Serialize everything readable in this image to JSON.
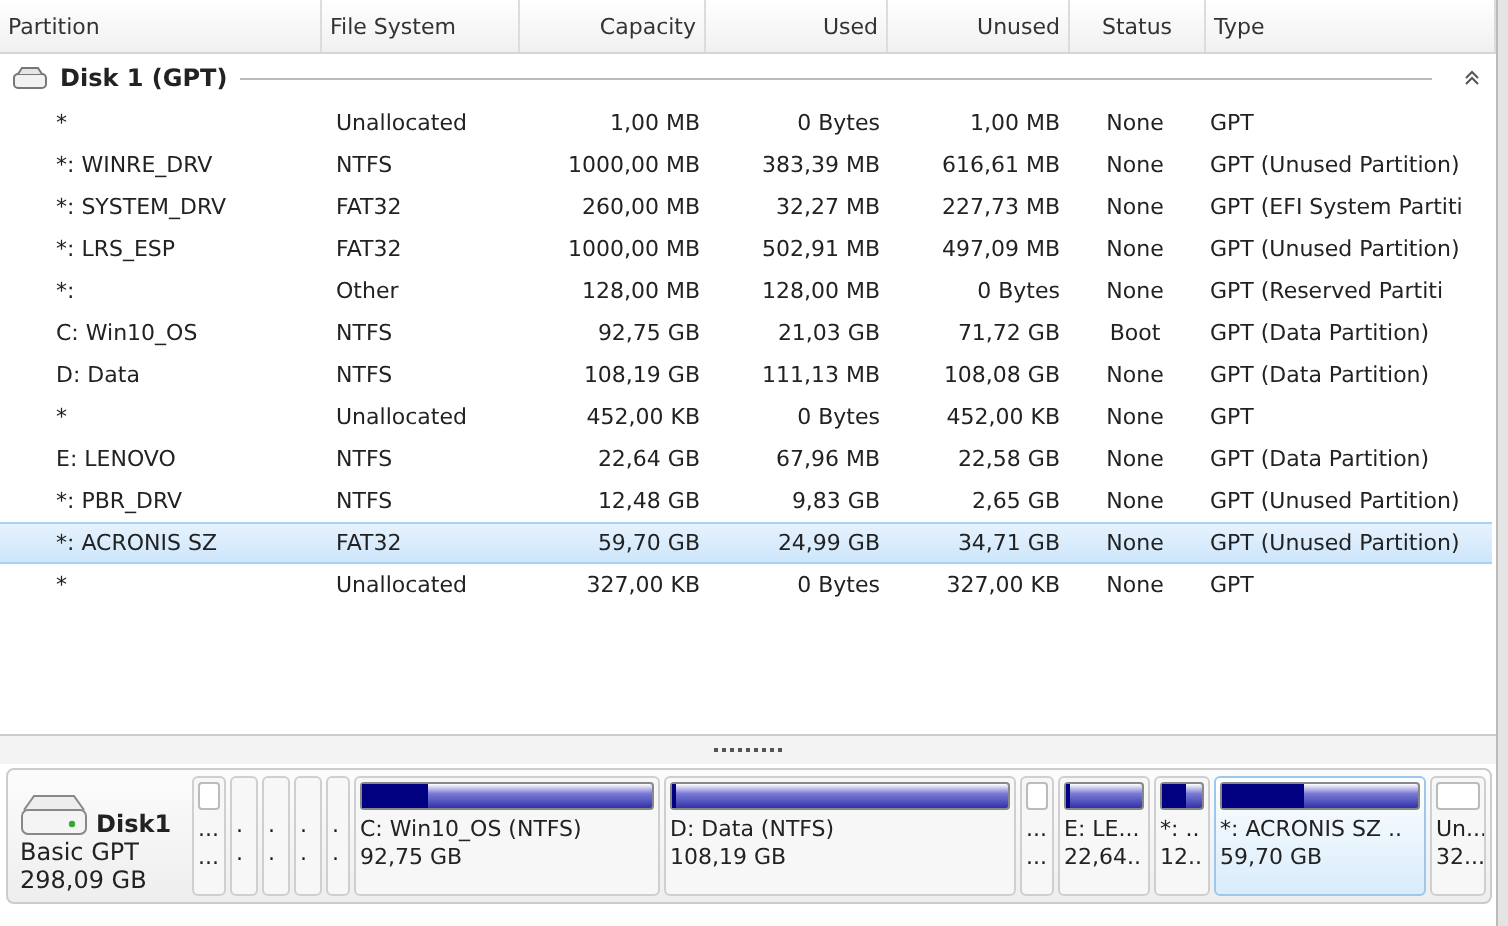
{
  "columns": [
    "Partition",
    "File System",
    "Capacity",
    "Used",
    "Unused",
    "Status",
    "Type"
  ],
  "disk_group": {
    "title": "Disk 1 (GPT)",
    "expanded": true
  },
  "rows": [
    {
      "cells": [
        "*",
        "Unallocated",
        "1,00 MB",
        "0 Bytes",
        "1,00 MB",
        "None",
        "GPT"
      ],
      "selected": false
    },
    {
      "cells": [
        "*: WINRE_DRV",
        "NTFS",
        "1000,00 MB",
        "383,39 MB",
        "616,61 MB",
        "None",
        "GPT (Unused Partition)"
      ],
      "selected": false
    },
    {
      "cells": [
        "*: SYSTEM_DRV",
        "FAT32",
        "260,00 MB",
        "32,27 MB",
        "227,73 MB",
        "None",
        "GPT (EFI System Partiti"
      ],
      "selected": false
    },
    {
      "cells": [
        "*: LRS_ESP",
        "FAT32",
        "1000,00 MB",
        "502,91 MB",
        "497,09 MB",
        "None",
        "GPT (Unused Partition)"
      ],
      "selected": false
    },
    {
      "cells": [
        "*:",
        "Other",
        "128,00 MB",
        "128,00 MB",
        "0 Bytes",
        "None",
        "GPT (Reserved Partiti"
      ],
      "selected": false
    },
    {
      "cells": [
        "C: Win10_OS",
        "NTFS",
        "92,75 GB",
        "21,03 GB",
        "71,72 GB",
        "Boot",
        "GPT (Data Partition)"
      ],
      "selected": false
    },
    {
      "cells": [
        "D: Data",
        "NTFS",
        "108,19 GB",
        "111,13 MB",
        "108,08 GB",
        "None",
        "GPT (Data Partition)"
      ],
      "selected": false
    },
    {
      "cells": [
        "*",
        "Unallocated",
        "452,00 KB",
        "0 Bytes",
        "452,00 KB",
        "None",
        "GPT"
      ],
      "selected": false
    },
    {
      "cells": [
        "E: LENOVO",
        "NTFS",
        "22,64 GB",
        "67,96 MB",
        "22,58 GB",
        "None",
        "GPT (Data Partition)"
      ],
      "selected": false
    },
    {
      "cells": [
        "*: PBR_DRV",
        "NTFS",
        "12,48 GB",
        "9,83 GB",
        "2,65 GB",
        "None",
        "GPT (Unused Partition)"
      ],
      "selected": false
    },
    {
      "cells": [
        "*: ACRONIS SZ",
        "FAT32",
        "59,70 GB",
        "24,99 GB",
        "34,71 GB",
        "None",
        "GPT (Unused Partition)"
      ],
      "selected": true
    },
    {
      "cells": [
        "*",
        "Unallocated",
        "327,00 KB",
        "0 Bytes",
        "327,00 KB",
        "None",
        "GPT"
      ],
      "selected": false
    }
  ],
  "disk_map": {
    "name": "Disk1",
    "type": "Basic GPT",
    "size": "298,09 GB",
    "blocks": [
      {
        "kind": "unallocated",
        "line1": "...",
        "line2": "...",
        "selected": false
      },
      {
        "kind": "none",
        "line1": ".",
        "line2": ".",
        "selected": false
      },
      {
        "kind": "none",
        "line1": ".",
        "line2": ".",
        "selected": false
      },
      {
        "kind": "none",
        "line1": ".",
        "line2": ".",
        "selected": false
      },
      {
        "kind": "none",
        "line1": ".",
        "line2": ".",
        "selected": false
      },
      {
        "kind": "partition",
        "line1": "C: Win10_OS (NTFS)",
        "line2": "92,75 GB",
        "level": 0.23,
        "selected": false
      },
      {
        "kind": "partition",
        "line1": "D: Data (NTFS)",
        "line2": "108,19 GB",
        "level": 0.01,
        "selected": false
      },
      {
        "kind": "unallocated",
        "line1": "...",
        "line2": "...",
        "selected": false
      },
      {
        "kind": "partition",
        "line1": "E: LE...",
        "line2": "22,64..",
        "level": 0.01,
        "selected": false
      },
      {
        "kind": "partition",
        "line1": "*: ..",
        "line2": "12..",
        "level": 0.6,
        "selected": false
      },
      {
        "kind": "partition",
        "line1": "*: ACRONIS SZ ..",
        "line2": "59,70 GB",
        "level": 0.42,
        "selected": true
      },
      {
        "kind": "unallocated",
        "line1": "Un...",
        "line2": "32...",
        "selected": false
      }
    ]
  }
}
